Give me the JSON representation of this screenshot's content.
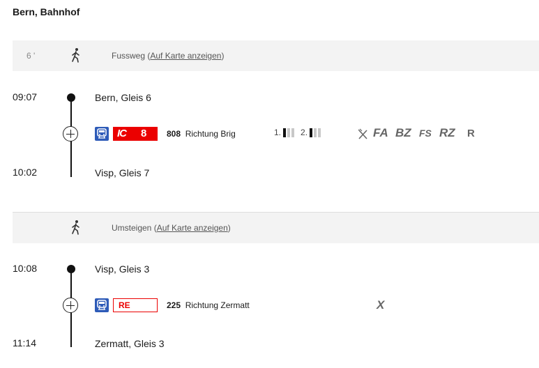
{
  "station_title": "Bern, Bahnhof",
  "walk_first": {
    "duration": "6 '",
    "text": "Fussweg (",
    "link": "Auf Karte anzeigen",
    "close": ")"
  },
  "section1": {
    "dep_time": "09:07",
    "dep_stop": "Bern, Gleis 6",
    "arr_time": "10:02",
    "arr_stop": "Visp, Gleis 7",
    "product": "IC",
    "line": "8",
    "train_number": "808",
    "direction": "Richtung Brig",
    "occupancy": [
      {
        "class_label": "1.",
        "level": 1
      },
      {
        "class_label": "2.",
        "level": 1
      }
    ],
    "attributes": [
      "FA",
      "BZ",
      "FS",
      "RZ"
    ],
    "attr_last": "R",
    "colors": {
      "sbb_red": "#eb0000",
      "train_blue": "#2e5bb8"
    }
  },
  "walk_transfer": {
    "text": "Umsteigen (",
    "link": "Auf Karte anzeigen",
    "close": ")"
  },
  "section2": {
    "dep_time": "10:08",
    "dep_stop": "Visp, Gleis 3",
    "arr_time": "11:14",
    "arr_stop": "Zermatt, Gleis 3",
    "product": "RE",
    "train_number": "225",
    "direction": "Richtung Zermatt",
    "attribute": "X"
  },
  "icons": [
    "walking-person-icon",
    "train-icon",
    "plus-circle-icon",
    "restaurant-icon",
    "occupancy-icon"
  ]
}
